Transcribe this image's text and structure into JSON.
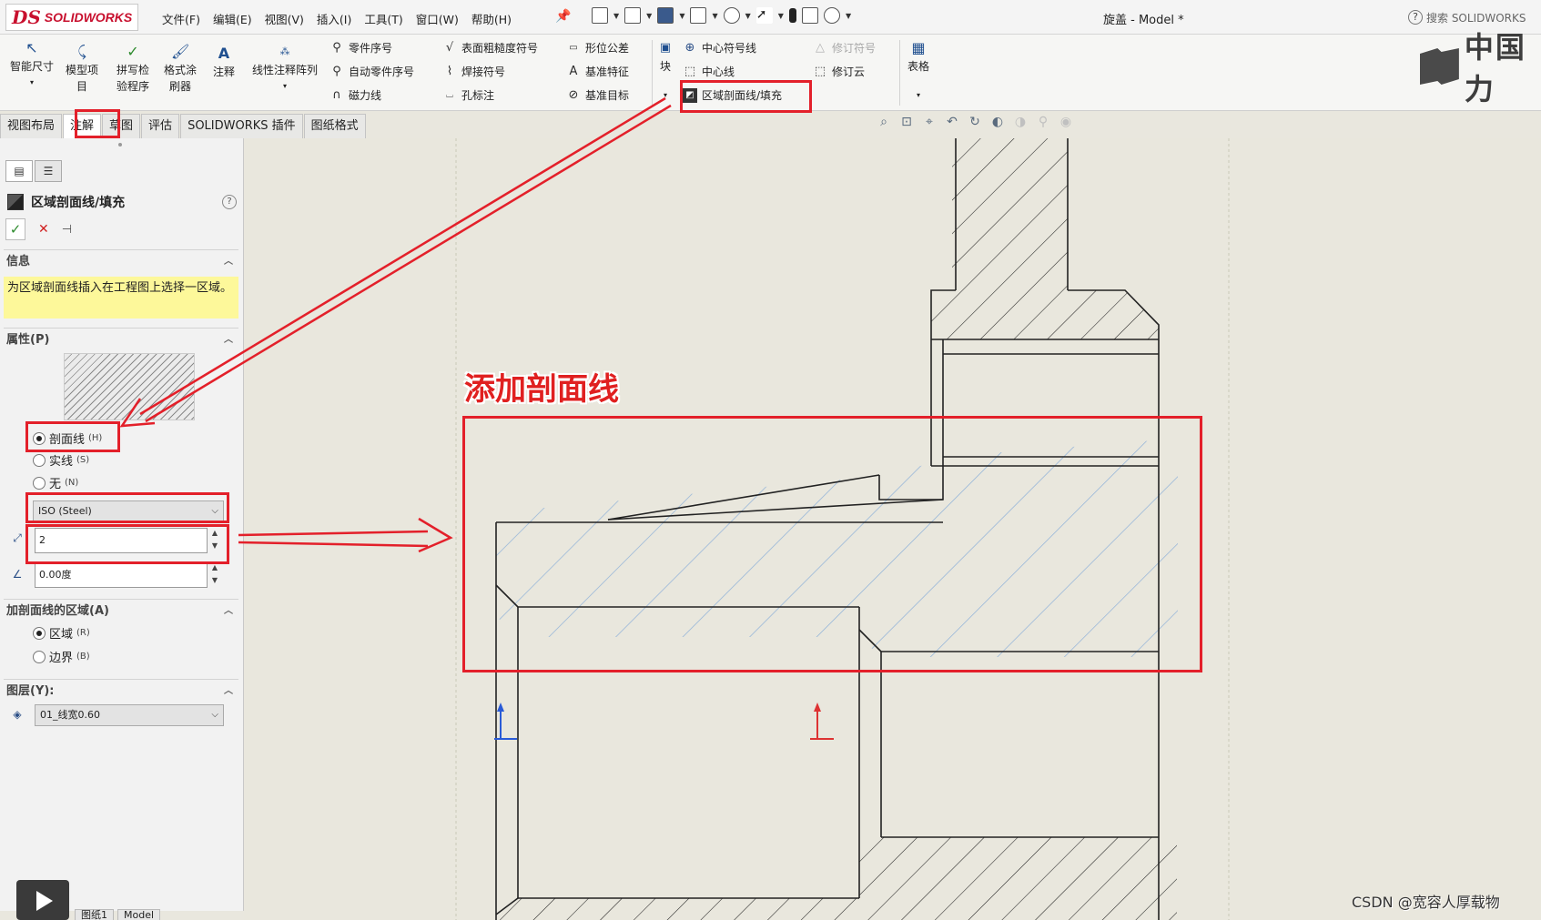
{
  "app": {
    "brand_mark": "DS",
    "brand_name": "SOLIDWORKS",
    "document_title": "旋盖 - Model *"
  },
  "menu": [
    "文件(F)",
    "编辑(E)",
    "视图(V)",
    "插入(I)",
    "工具(T)",
    "窗口(W)",
    "帮助(H)"
  ],
  "search": {
    "label": "搜索 SOLIDWORKS"
  },
  "ribbon": {
    "smart_dim": "智能尺寸",
    "model_items": [
      "模型项",
      "目"
    ],
    "spell_check": [
      "拼写检",
      "验程序"
    ],
    "format_painter": [
      "格式涂",
      "刷器"
    ],
    "note": "注释",
    "linear_note_pattern": "线性注释阵列",
    "balloon": "零件序号",
    "auto_balloon": "自动零件序号",
    "magnetic_line": "磁力线",
    "surface_finish": "表面粗糙度符号",
    "weld_symbol": "焊接符号",
    "hole_callout": "孔标注",
    "gtol": "形位公差",
    "datum_feature": "基准特征",
    "datum_target": "基准目标",
    "block": "块",
    "center_mark": "中心符号线",
    "centerline": "中心线",
    "area_hatch": "区域剖面线/填充",
    "revision_symbol": "修订符号",
    "revision_cloud": "修订云",
    "table": "表格",
    "brand_right": "中国力"
  },
  "tabs": [
    "视图布局",
    "注解",
    "草图",
    "评估",
    "SOLIDWORKS 插件",
    "图纸格式"
  ],
  "panel": {
    "title": "区域剖面线/填充",
    "info_header": "信息",
    "info_text": "为区域剖面线插入在工程图上选择一区域。",
    "props_header": "属性(P)",
    "radio_hatch": "剖面线",
    "radio_hatch_key": "(H)",
    "radio_solid": "实线",
    "radio_solid_key": "(S)",
    "radio_none": "无",
    "radio_none_key": "(N)",
    "pattern": "ISO (Steel)",
    "scale": "2",
    "angle": "0.00度",
    "region_header": "加剖面线的区域(A)",
    "radio_region": "区域",
    "radio_region_key": "(R)",
    "radio_boundary": "边界",
    "radio_boundary_key": "(B)",
    "layer_header": "图层(Y):",
    "layer_value": "01_线宽0.60"
  },
  "bottom_tabs": [
    "图纸1",
    "Model"
  ],
  "annotation": {
    "caption": "添加剖面线"
  },
  "watermark": "CSDN @宽容人厚载物",
  "colors": {
    "highlight": "#e3202a",
    "hatch_blue": "#8fb1d8",
    "info_bg": "#fdf89a"
  }
}
